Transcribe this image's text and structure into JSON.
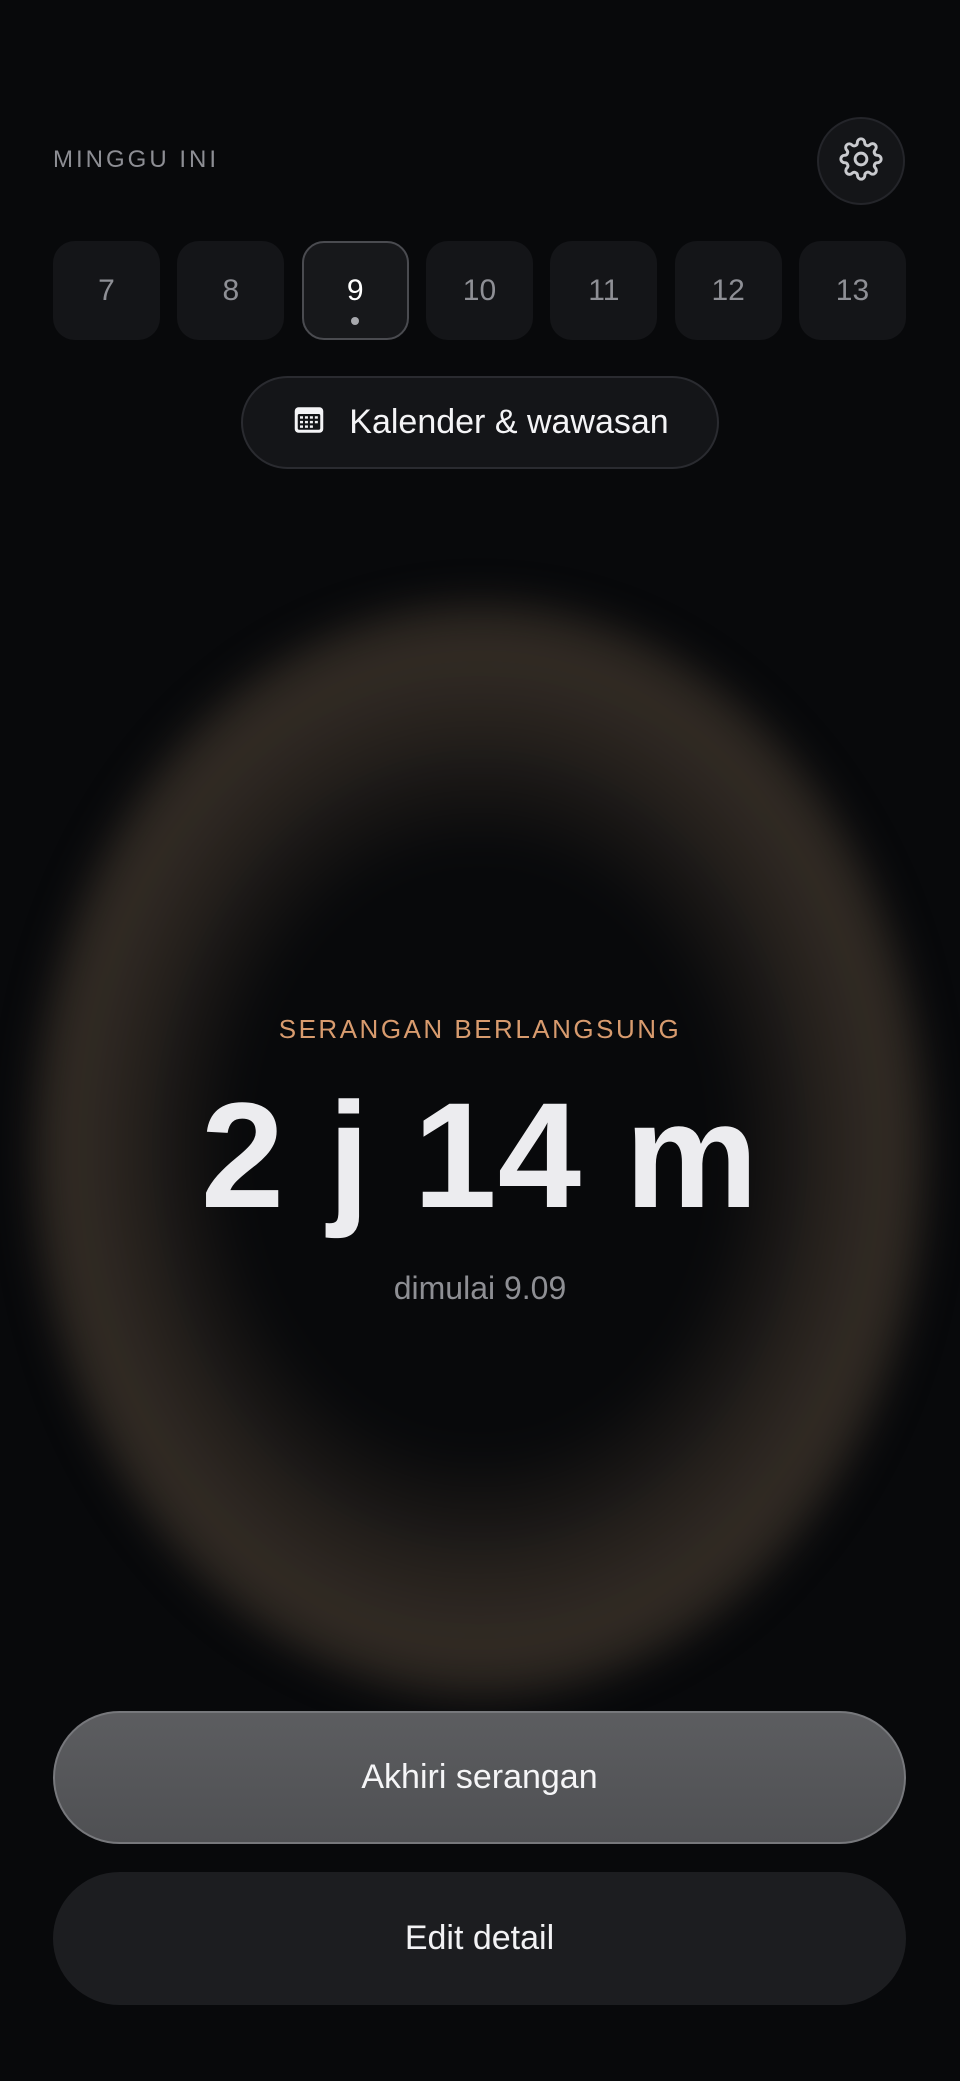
{
  "header": {
    "week_label": "MINGGU INI",
    "settings_icon": "gear-icon"
  },
  "days": [
    {
      "label": "7",
      "selected": false
    },
    {
      "label": "8",
      "selected": false
    },
    {
      "label": "9",
      "selected": true,
      "has_dot": true
    },
    {
      "label": "10",
      "selected": false
    },
    {
      "label": "11",
      "selected": false
    },
    {
      "label": "12",
      "selected": false
    },
    {
      "label": "13",
      "selected": false
    }
  ],
  "calendar_button": {
    "icon": "calendar-icon",
    "label": "Kalender & wawasan"
  },
  "attack": {
    "status_label": "SERANGAN BERLANGSUNG",
    "duration": "2 j 14 m",
    "started": "dimulai 9.09"
  },
  "actions": {
    "end_label": "Akhiri serangan",
    "edit_label": "Edit detail"
  },
  "colors": {
    "background": "#08090b",
    "accent": "#d89b6e",
    "glow": "#42382e"
  }
}
